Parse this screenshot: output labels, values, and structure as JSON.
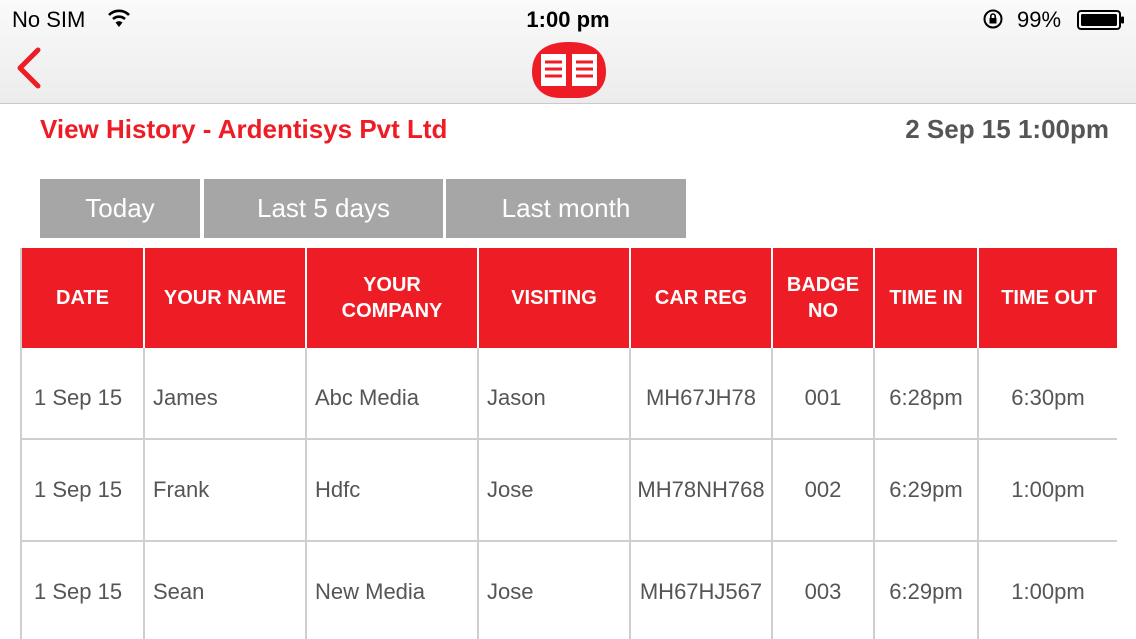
{
  "status_bar": {
    "carrier": "No SIM",
    "time": "1:00 pm",
    "battery_percent": "99%"
  },
  "nav": {
    "back_icon": "chevron-left-icon",
    "logo_icon": "open-book-icon"
  },
  "header": {
    "title": "View History - Ardentisys Pvt Ltd",
    "datetime": "2 Sep 15 1:00pm"
  },
  "filters": [
    {
      "label": "Today"
    },
    {
      "label": "Last 5 days"
    },
    {
      "label": "Last month"
    }
  ],
  "table": {
    "columns": [
      "DATE",
      "YOUR NAME",
      "YOUR COMPANY",
      "VISITING",
      "CAR REG",
      "BADGE NO",
      "TIME IN",
      "TIME OUT"
    ],
    "rows": [
      [
        "1 Sep 15",
        "James",
        "Abc Media",
        "Jason",
        "MH67JH78",
        "001",
        "6:28pm",
        "6:30pm"
      ],
      [
        "1 Sep 15",
        "Frank",
        "Hdfc",
        "Jose",
        "MH78NH768",
        "002",
        "6:29pm",
        "1:00pm"
      ],
      [
        "1 Sep 15",
        "Sean",
        "New Media",
        "Jose",
        "MH67HJ567",
        "003",
        "6:29pm",
        "1:00pm"
      ]
    ]
  },
  "colors": {
    "accent": "#ee1c24",
    "tab_bg": "#a6a6a6",
    "text_muted": "#555555"
  }
}
